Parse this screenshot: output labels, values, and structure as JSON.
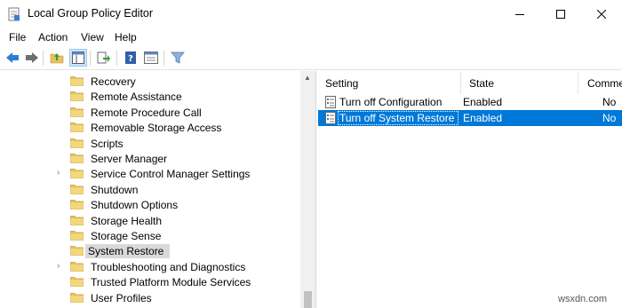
{
  "window": {
    "title": "Local Group Policy Editor",
    "icon": "policy-editor-icon"
  },
  "menu": [
    "File",
    "Action",
    "View",
    "Help"
  ],
  "toolbar": {
    "icons": [
      "back-arrow-icon",
      "forward-arrow-icon",
      "up-folder-icon",
      "show-hide-tree-icon",
      "export-list-icon",
      "help-icon",
      "properties-icon",
      "filter-icon"
    ]
  },
  "tree": {
    "items": [
      {
        "label": "Recovery",
        "expandable": false
      },
      {
        "label": "Remote Assistance",
        "expandable": false
      },
      {
        "label": "Remote Procedure Call",
        "expandable": false
      },
      {
        "label": "Removable Storage Access",
        "expandable": false
      },
      {
        "label": "Scripts",
        "expandable": false
      },
      {
        "label": "Server Manager",
        "expandable": false
      },
      {
        "label": "Service Control Manager Settings",
        "expandable": true
      },
      {
        "label": "Shutdown",
        "expandable": false
      },
      {
        "label": "Shutdown Options",
        "expandable": false
      },
      {
        "label": "Storage Health",
        "expandable": false
      },
      {
        "label": "Storage Sense",
        "expandable": false
      },
      {
        "label": "System Restore",
        "expandable": false,
        "selected": true
      },
      {
        "label": "Troubleshooting and Diagnostics",
        "expandable": true
      },
      {
        "label": "Trusted Platform Module Services",
        "expandable": false
      },
      {
        "label": "User Profiles",
        "expandable": false
      }
    ]
  },
  "list": {
    "columns": [
      "Setting",
      "State",
      "Comme"
    ],
    "rows": [
      {
        "setting": "Turn off Configuration",
        "state": "Enabled",
        "comment": "No",
        "selected": false
      },
      {
        "setting": "Turn off System Restore",
        "state": "Enabled",
        "comment": "No",
        "selected": true
      }
    ]
  },
  "watermark": "wsxdn.com",
  "colors": {
    "selection": "#0078d7",
    "tree_selection": "#d9d9d9",
    "folder": "#e8c35a"
  }
}
